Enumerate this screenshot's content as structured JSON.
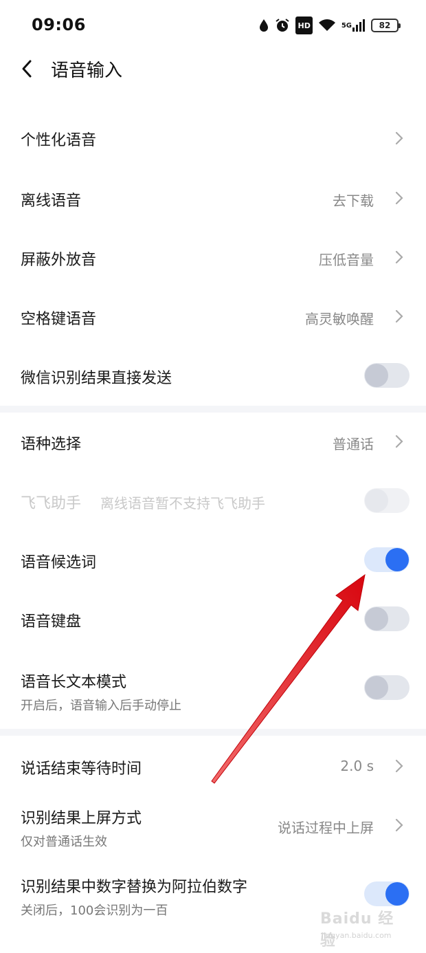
{
  "status_bar": {
    "time": "09:06",
    "network": "5G",
    "hd_label": "HD",
    "battery": "82",
    "icons": [
      "drop-icon",
      "alarm-icon",
      "hd-icon",
      "wifi-icon",
      "5g-signal-icon",
      "battery-icon"
    ]
  },
  "header": {
    "title": "语音输入",
    "back_icon": "chevron-left-icon"
  },
  "sections": [
    {
      "items": [
        {
          "label": "个性化语音",
          "value": "",
          "control": "chevron"
        },
        {
          "label": "离线语音",
          "value": "去下载",
          "control": "chevron"
        },
        {
          "label": "屏蔽外放音",
          "value": "压低音量",
          "control": "chevron"
        },
        {
          "label": "空格键语音",
          "value": "高灵敏唤醒",
          "control": "chevron"
        },
        {
          "label": "微信识别结果直接发送",
          "control": "toggle",
          "state": "off"
        }
      ]
    },
    {
      "items": [
        {
          "label": "语种选择",
          "value": "普通话",
          "control": "chevron"
        },
        {
          "label": "飞飞助手",
          "note": "离线语音暂不支持飞飞助手",
          "control": "toggle",
          "state": "disabled"
        },
        {
          "label": "语音候选词",
          "control": "toggle",
          "state": "on"
        },
        {
          "label": "语音键盘",
          "control": "toggle",
          "state": "off"
        },
        {
          "label": "语音长文本模式",
          "sub": "开启后，语音输入后手动停止",
          "control": "toggle",
          "state": "off"
        }
      ]
    },
    {
      "items": [
        {
          "label": "说话结束等待时间",
          "value": "2.0 s",
          "control": "chevron"
        },
        {
          "label": "识别结果上屏方式",
          "sub": "仅对普通话生效",
          "value": "说话过程中上屏",
          "control": "chevron"
        },
        {
          "label": "识别结果中数字替换为阿拉伯数字",
          "sub": "关闭后，100会识别为一百",
          "control": "toggle",
          "state": "on"
        }
      ]
    }
  ],
  "annotation": {
    "type": "red-arrow",
    "color": "#e8121b"
  },
  "watermark": {
    "brand": "Baidu 经验",
    "url": "jingyan.baidu.com"
  },
  "colors": {
    "accent": "#2b6ff3",
    "toggle_track_off": "#e3e6ec",
    "toggle_knob_off": "#c6cad5",
    "divider": "#f4f5f8"
  }
}
